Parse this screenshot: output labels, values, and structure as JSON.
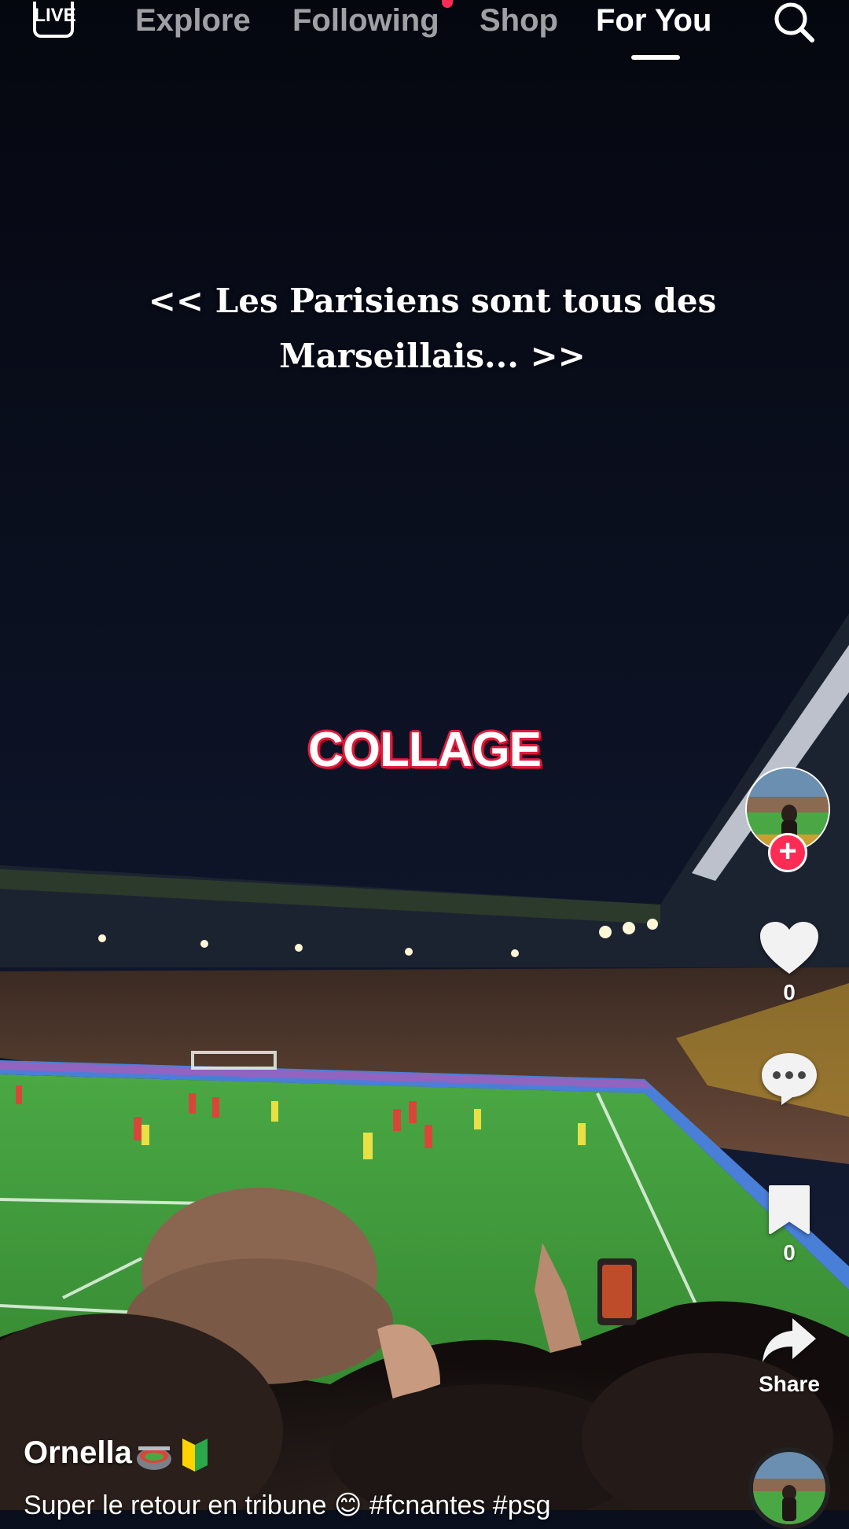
{
  "top_nav": {
    "live_label": "LIVE",
    "tabs": [
      {
        "label": "Explore",
        "active": false
      },
      {
        "label": "Following",
        "active": false,
        "has_notification_dot": true
      },
      {
        "label": "Shop",
        "active": false
      },
      {
        "label": "For You",
        "active": true
      }
    ],
    "search_icon": "search-icon"
  },
  "overlay": {
    "quote_line1": "<< Les Parisiens sont tous des",
    "quote_line2": "Marseillais... >>",
    "sticker": "COLLAGE"
  },
  "actions": {
    "like_count": "0",
    "save_count": "0",
    "share_label": "Share",
    "comment_count": "",
    "icons": [
      "heart-icon",
      "comment-icon",
      "bookmark-icon",
      "share-arrow-icon"
    ]
  },
  "post": {
    "username": "Ornella",
    "username_emojis": [
      "stadium",
      "japanese-beginner-symbol"
    ],
    "caption": "Super le retour en tribune 😊 #fcnantes #psg"
  },
  "colors": {
    "accent": "#fe2c55",
    "sticker_outline": "#e21b3c",
    "pitch": "#3f9a3a",
    "night_sky": "#0a0f1e"
  }
}
